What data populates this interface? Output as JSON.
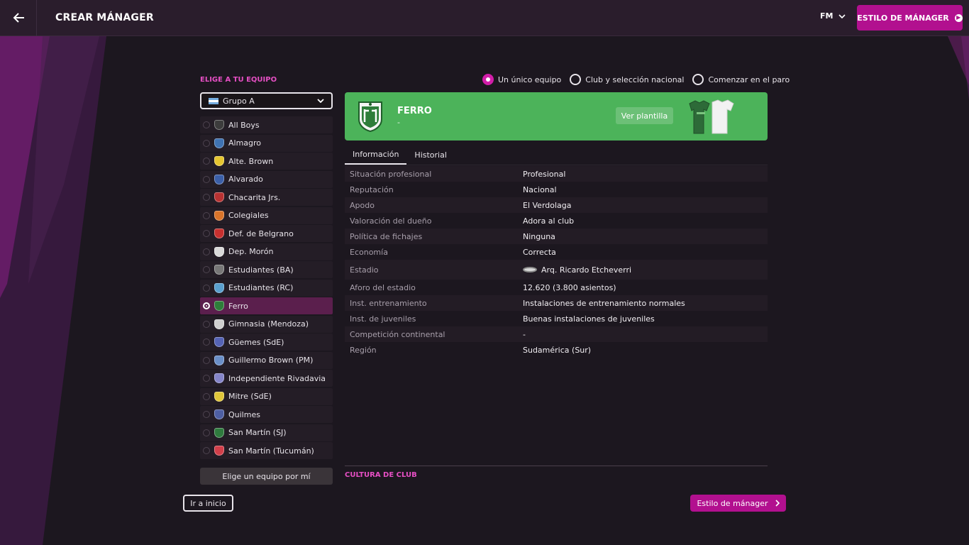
{
  "header": {
    "back_icon": "arrow-left-icon",
    "title": "CREAR MÁNAGER",
    "fm_label": "FM",
    "style_button": "ESTILO DE MÁNAGER"
  },
  "left": {
    "section_label": "ELIGE A TU EQUIPO",
    "group_select": {
      "value": "Grupo A"
    },
    "teams": [
      {
        "name": "All Boys",
        "color": "#3c3c3c",
        "selected": false
      },
      {
        "name": "Almagro",
        "color": "#3f73b3",
        "selected": false
      },
      {
        "name": "Alte. Brown",
        "color": "#e5c530",
        "selected": false
      },
      {
        "name": "Alvarado",
        "color": "#3b5fa8",
        "selected": false
      },
      {
        "name": "Chacarita Jrs.",
        "color": "#b83232",
        "selected": false
      },
      {
        "name": "Colegiales",
        "color": "#d9742a",
        "selected": false
      },
      {
        "name": "Def. de Belgrano",
        "color": "#c7302f",
        "selected": false
      },
      {
        "name": "Dep. Morón",
        "color": "#d9d9d9",
        "selected": false
      },
      {
        "name": "Estudiantes (BA)",
        "color": "#777777",
        "selected": false
      },
      {
        "name": "Estudiantes (RC)",
        "color": "#5aa0cf",
        "selected": false
      },
      {
        "name": "Ferro",
        "color": "#2e7d3a",
        "selected": true
      },
      {
        "name": "Gimnasia (Mendoza)",
        "color": "#cfcfcf",
        "selected": false
      },
      {
        "name": "Güemes (SdE)",
        "color": "#5563b5",
        "selected": false
      },
      {
        "name": "Guillermo Brown (PM)",
        "color": "#6a8fc8",
        "selected": false
      },
      {
        "name": "Independiente Rivadavia",
        "color": "#8585c9",
        "selected": false
      },
      {
        "name": "Mitre (SdE)",
        "color": "#e0c63a",
        "selected": false
      },
      {
        "name": "Quilmes",
        "color": "#4e5fa3",
        "selected": false
      },
      {
        "name": "San Martín (SJ)",
        "color": "#2f7b3e",
        "selected": false
      },
      {
        "name": "San Martín (Tucumán)",
        "color": "#d23f4a",
        "selected": false
      }
    ],
    "random_button": "Elige un equipo por mí",
    "home_button": "Ir a inicio"
  },
  "mode_options": [
    {
      "label": "Un único equipo",
      "selected": true
    },
    {
      "label": "Club y selección nacional",
      "selected": false
    },
    {
      "label": "Comenzar en el paro",
      "selected": false
    }
  ],
  "club": {
    "name": "FERRO",
    "subtitle": "-",
    "squad_button": "Ver plantilla",
    "banner_color": "#4cb35a"
  },
  "tabs": [
    {
      "label": "Información",
      "active": true
    },
    {
      "label": "Historial",
      "active": false
    }
  ],
  "info": [
    {
      "label": "Situación profesional",
      "value": "Profesional"
    },
    {
      "label": "Reputación",
      "value": "Nacional"
    },
    {
      "label": "Apodo",
      "value": "El Verdolaga"
    },
    {
      "label": "Valoración del dueño",
      "value": "Adora al club"
    },
    {
      "label": "Política de fichajes",
      "value": "Ninguna"
    },
    {
      "label": "Economía",
      "value": "Correcta"
    },
    {
      "label": "Estadio",
      "value": "Arq. Ricardo Etcheverri",
      "icon": "stadium-icon"
    },
    {
      "label": "Aforo del estadio",
      "value": "12.620 (3.800 asientos)"
    },
    {
      "label": "Inst. entrenamiento",
      "value": "Instalaciones de entrenamiento normales"
    },
    {
      "label": "Inst. de juveniles",
      "value": "Buenas instalaciones de juveniles"
    },
    {
      "label": "Competición continental",
      "value": "-"
    },
    {
      "label": "Región",
      "value": "Sudamérica (Sur)"
    }
  ],
  "culture_label": "CULTURA DE CLUB",
  "next_button": "Estilo de mánager",
  "colors": {
    "accent": "#b2108f",
    "accent_text": "#e64fc4",
    "selected_row": "#5b1f4d"
  }
}
